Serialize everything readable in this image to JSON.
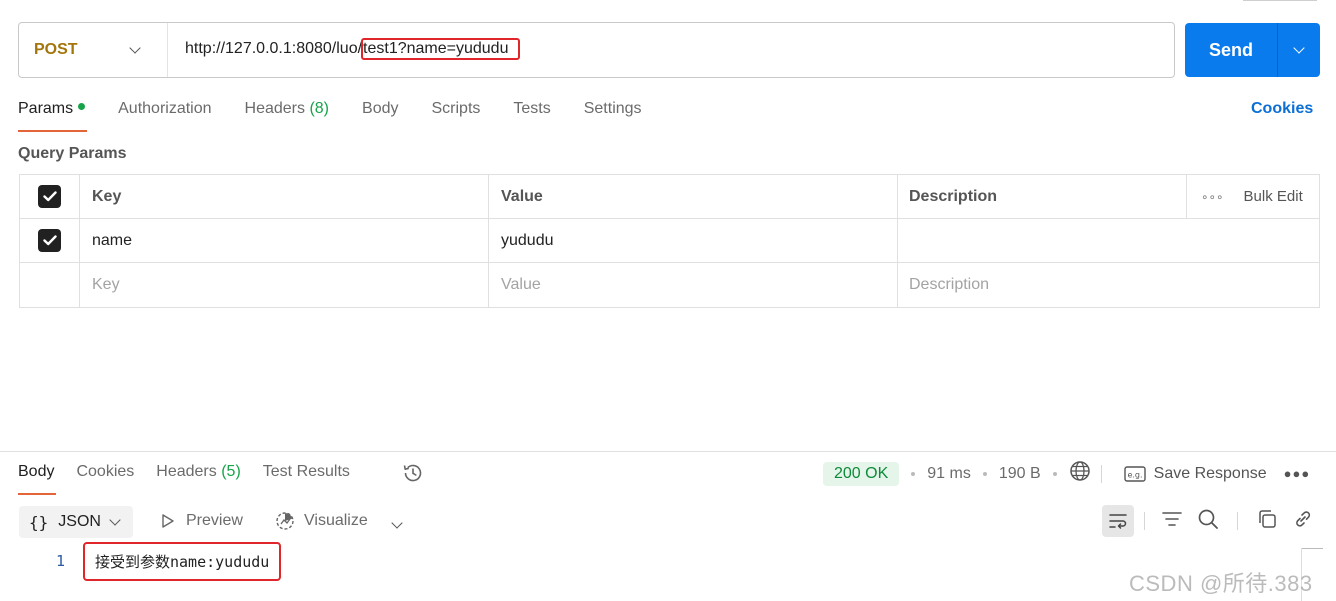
{
  "request": {
    "method": "POST",
    "url_prefix": "http://127.0.0.1:8080/luo/",
    "url_highlight": "test1?name=yududu",
    "send_label": "Send"
  },
  "request_tabs": [
    {
      "label": "Params",
      "active": true
    },
    {
      "label": "Authorization"
    },
    {
      "label": "Headers",
      "count": "(8)"
    },
    {
      "label": "Body"
    },
    {
      "label": "Scripts"
    },
    {
      "label": "Tests"
    },
    {
      "label": "Settings"
    }
  ],
  "cookies_label": "Cookies",
  "query_params": {
    "title": "Query Params",
    "columns": {
      "key": "Key",
      "value": "Value",
      "description": "Description",
      "bulk_edit": "Bulk Edit"
    },
    "rows": [
      {
        "checked": true,
        "key": "name",
        "value": "yududu",
        "description": ""
      }
    ],
    "placeholders": {
      "key": "Key",
      "value": "Value",
      "description": "Description"
    }
  },
  "response_tabs": [
    {
      "label": "Body",
      "active": true
    },
    {
      "label": "Cookies"
    },
    {
      "label": "Headers",
      "count": "(5)"
    },
    {
      "label": "Test Results"
    }
  ],
  "response_status": {
    "status": "200 OK",
    "time": "91 ms",
    "size": "190 B",
    "save_label": "Save Response"
  },
  "response_toolbar": {
    "format": "JSON",
    "preview": "Preview",
    "visualize": "Visualize"
  },
  "response_body": {
    "line_number": "1",
    "text": "接受到参数name:yududu"
  },
  "watermark": "CSDN @所待.383",
  "colors": {
    "method": "#a3750b",
    "send": "#097bed",
    "active_tab_underline": "#e4653a",
    "count": "#17a34a",
    "status_ok": "#0e8a39",
    "highlight_box": "#e0262a",
    "link": "#0b6fd6"
  }
}
